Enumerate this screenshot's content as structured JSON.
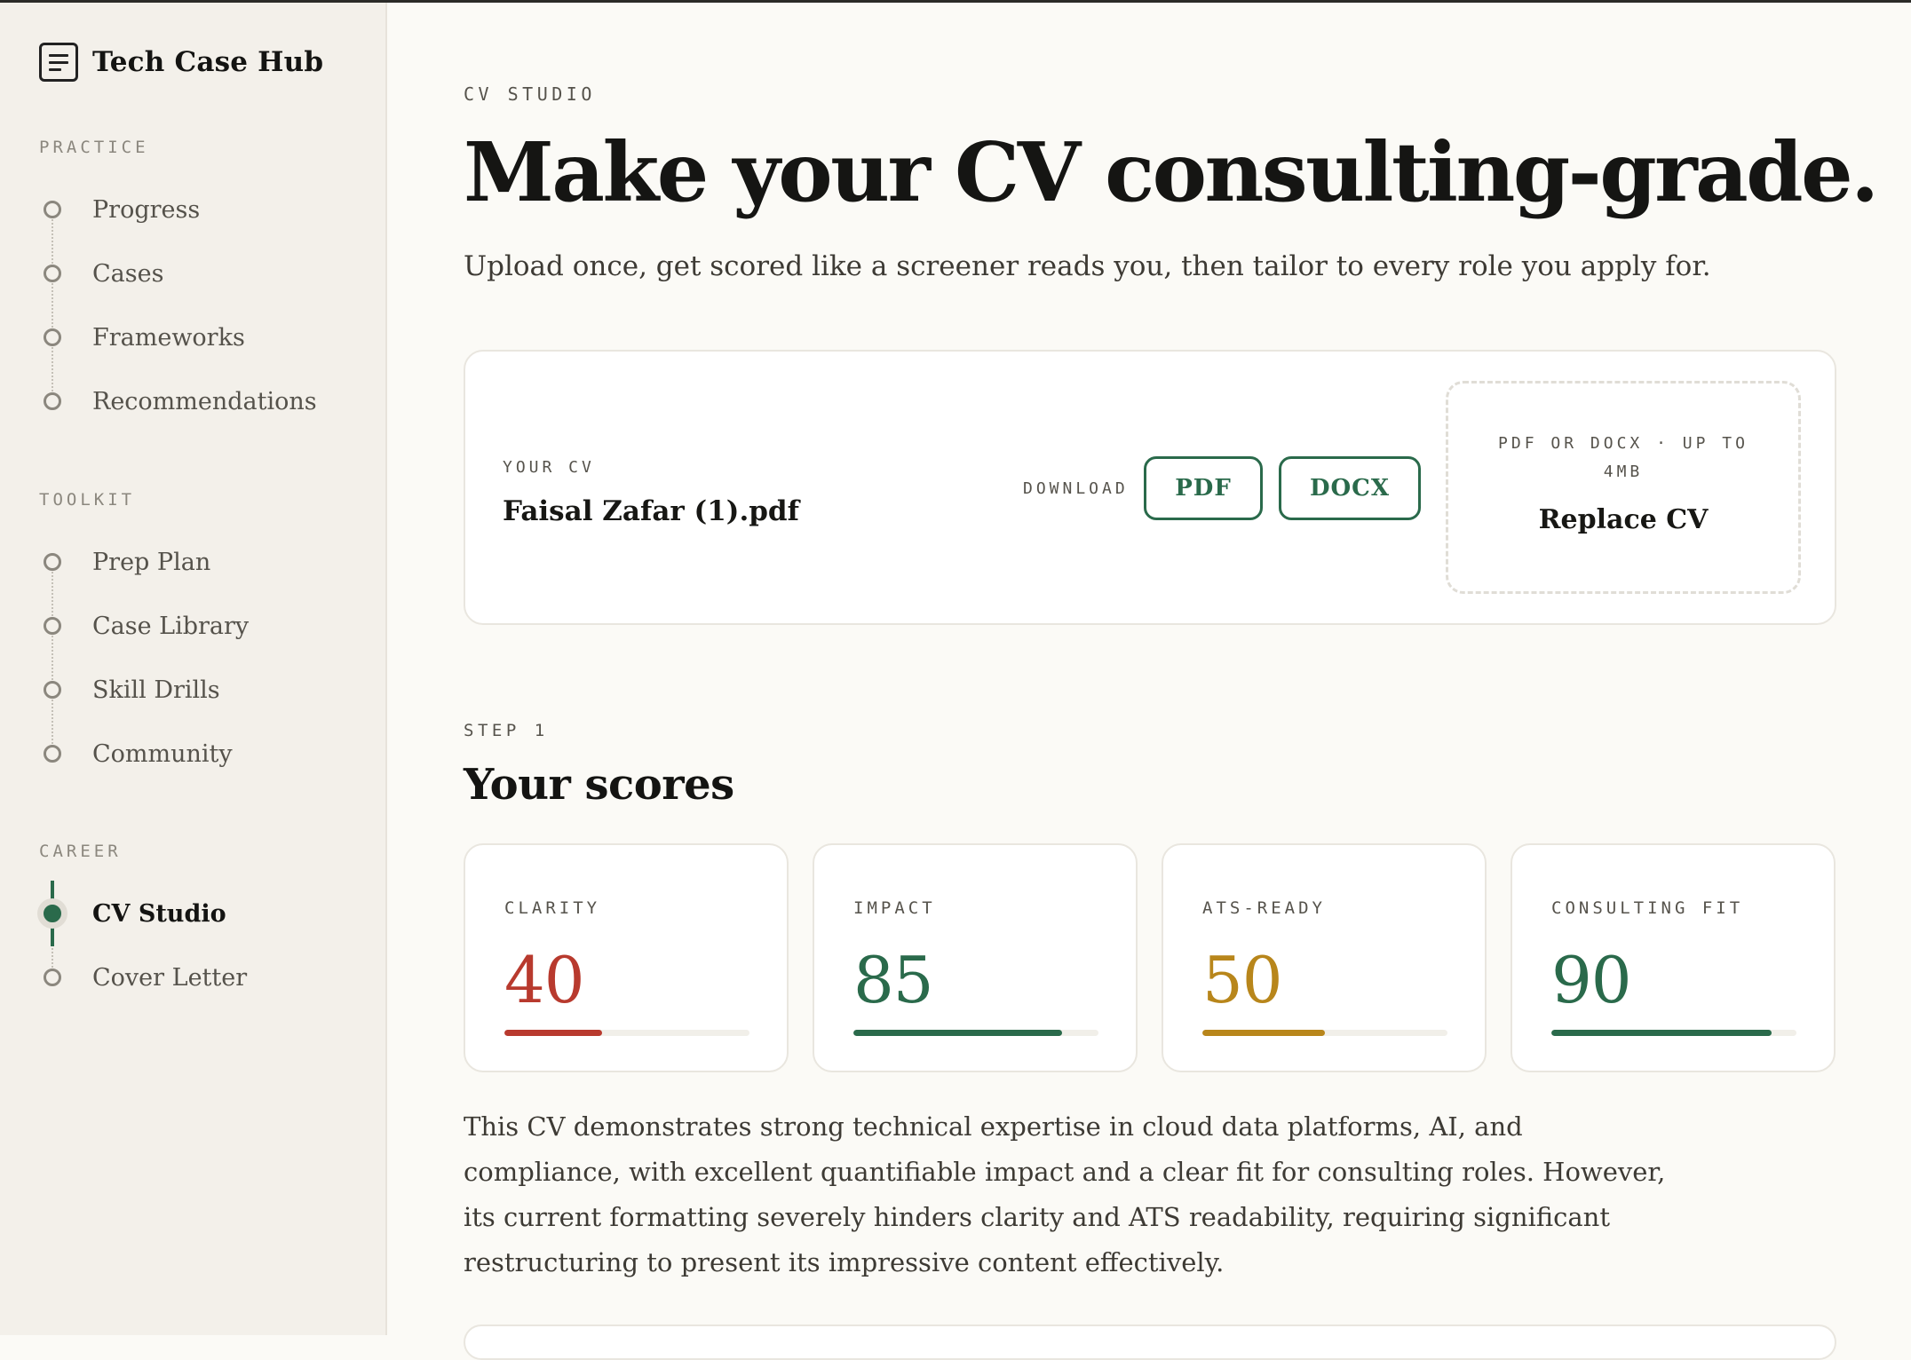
{
  "app": {
    "title": "Tech Case Hub",
    "icon": "document-lines-icon"
  },
  "sidebar": {
    "sections": [
      {
        "label": "PRACTICE",
        "items": [
          "Progress",
          "Cases",
          "Frameworks",
          "Recommendations"
        ]
      },
      {
        "label": "TOOLKIT",
        "items": [
          "Prep Plan",
          "Case Library",
          "Skill Drills",
          "Community"
        ]
      },
      {
        "label": "CAREER",
        "items": [
          "CV Studio",
          "Cover Letter"
        ],
        "active": "CV Studio"
      }
    ]
  },
  "page": {
    "eyebrow": "CV STUDIO",
    "title": "Make your CV consulting-grade.",
    "subtitle": "Upload once, get scored like a screener reads you, then tailor to every role you apply for."
  },
  "cv": {
    "label": "YOUR CV",
    "file_name": "Faisal Zafar (1).pdf",
    "download_label": "DOWNLOAD",
    "pdf_button": "PDF",
    "docx_button": "DOCX",
    "upload_hint": "PDF OR DOCX · UP TO 4MB",
    "replace_label": "Replace CV"
  },
  "scores": {
    "step": "STEP 1",
    "title": "Your scores",
    "items": [
      {
        "label": "CLARITY",
        "value": 40,
        "color": "#b83a2e"
      },
      {
        "label": "IMPACT",
        "value": 85,
        "color": "#2a6a4b"
      },
      {
        "label": "ATS-READY",
        "value": 50,
        "color": "#b8861b"
      },
      {
        "label": "CONSULTING FIT",
        "value": 90,
        "color": "#2a6a4b"
      }
    ],
    "summary": "This CV demonstrates strong technical expertise in cloud data platforms, AI, and compliance, with excellent quantifiable impact and a clear fit for consulting roles. However, its current formatting severely hinders clarity and ATS readability, requiring significant restructuring to present its impressive content effectively."
  },
  "colors": {
    "accent": "#2a6a4b",
    "sidebar_bg": "#f3f0ea",
    "page_bg": "#fbfaf6"
  }
}
